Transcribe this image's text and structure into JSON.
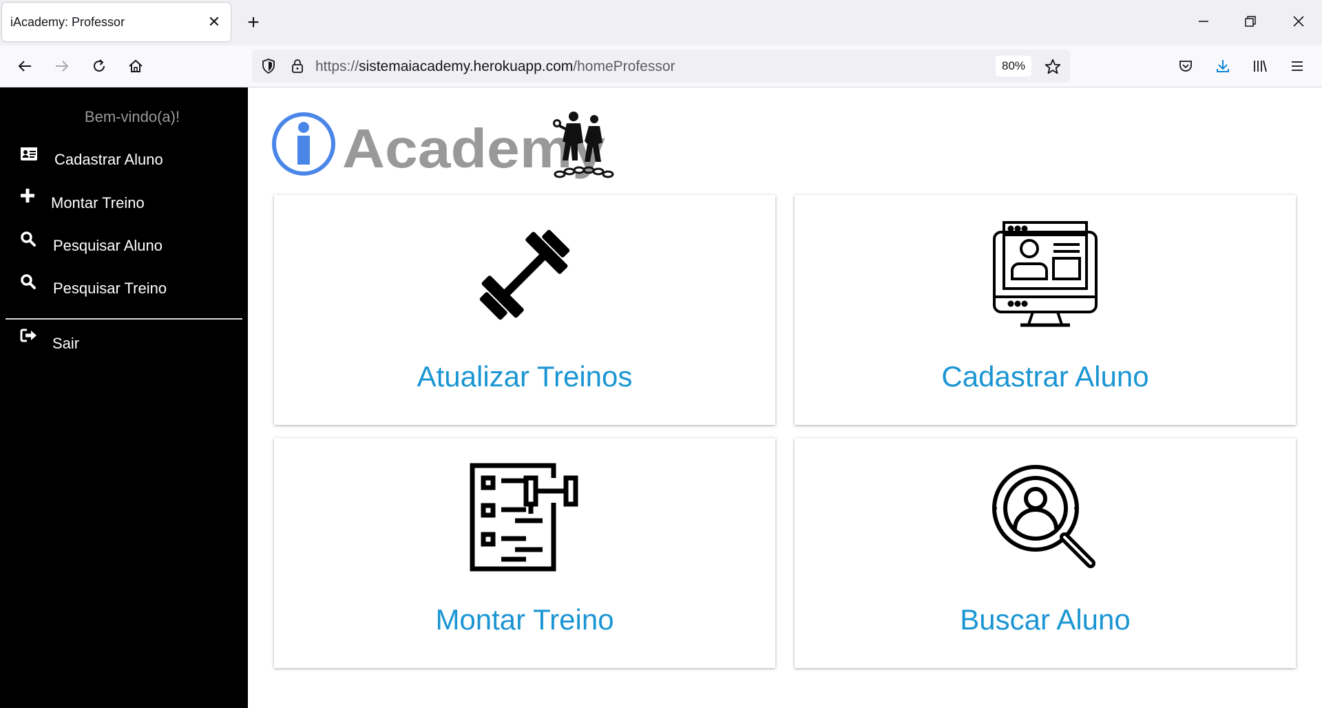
{
  "browser": {
    "tab_title": "iAcademy: Professor",
    "tab_close": "✕",
    "new_tab": "+",
    "url_scheme": "https://",
    "url_host": "sistemaiacademy.herokuapp.com",
    "url_path": "/homeProfessor",
    "zoom": "80%",
    "icons": [
      "back-icon",
      "forward-icon",
      "reload-icon",
      "home-icon",
      "shield-icon",
      "lock-icon",
      "bookmark-star-icon",
      "pocket-icon",
      "download-icon",
      "library-icon",
      "menu-icon"
    ]
  },
  "sidebar": {
    "welcome": "Bem-vindo(a)!",
    "items": [
      {
        "label": "Cadastrar Aluno",
        "icon": "id-card-icon"
      },
      {
        "label": "Montar Treino",
        "icon": "plus-icon"
      },
      {
        "label": "Pesquisar Aluno",
        "icon": "search-icon"
      },
      {
        "label": "Pesquisar Treino",
        "icon": "search-icon"
      }
    ],
    "logout": {
      "label": "Sair",
      "icon": "sign-out-icon"
    }
  },
  "logo": {
    "text": "Academy",
    "letter": "i"
  },
  "cards": [
    {
      "label": "Atualizar Treinos",
      "icon": "dumbbell-icon"
    },
    {
      "label": "Cadastrar Aluno",
      "icon": "student-profile-monitor-icon"
    },
    {
      "label": "Montar Treino",
      "icon": "workout-checklist-icon"
    },
    {
      "label": "Buscar Aluno",
      "icon": "user-search-icon"
    }
  ],
  "colors": {
    "accent": "#1a95d3",
    "sidebar_bg": "#000000",
    "logo_blue": "#4a86e8",
    "logo_gray": "#999999"
  }
}
